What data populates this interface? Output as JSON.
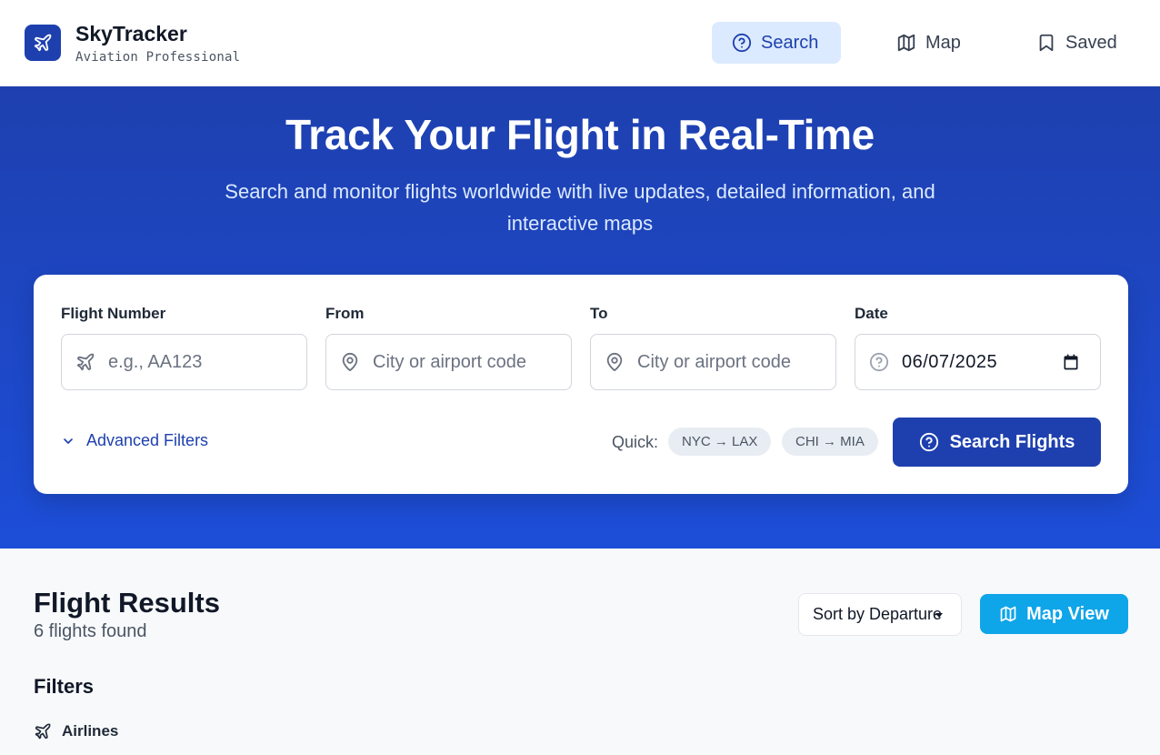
{
  "header": {
    "brand_name": "SkyTracker",
    "brand_sub": "Aviation Professional",
    "nav": [
      {
        "label": "Search",
        "icon": "help-circle-icon",
        "active": true
      },
      {
        "label": "Map",
        "icon": "map-icon",
        "active": false
      },
      {
        "label": "Saved",
        "icon": "bookmark-icon",
        "active": false
      }
    ]
  },
  "hero": {
    "title": "Track Your Flight in Real-Time",
    "subtitle": "Search and monitor flights worldwide with live updates, detailed information, and interactive maps"
  },
  "search_form": {
    "flight_number": {
      "label": "Flight Number",
      "placeholder": "e.g., AA123",
      "icon": "plane-icon"
    },
    "from": {
      "label": "From",
      "placeholder": "City or airport code",
      "icon": "map-pin-icon"
    },
    "to": {
      "label": "To",
      "placeholder": "City or airport code",
      "icon": "map-pin-icon"
    },
    "date": {
      "label": "Date",
      "value": "06/07/2025",
      "icon": "help-circle-icon"
    },
    "advanced_filters_label": "Advanced Filters",
    "quick_label": "Quick:",
    "quick_chips": [
      "NYC → LAX",
      "CHI → MIA"
    ],
    "submit_label": "Search Flights"
  },
  "results": {
    "title": "Flight Results",
    "count_text": "6 flights found",
    "sort_value": "Sort by Departure",
    "map_view_label": "Map View",
    "filters_title": "Filters",
    "airlines_label": "Airlines"
  },
  "colors": {
    "primary": "#1e40af",
    "accent": "#0ea5e9",
    "nav_active_bg": "#dbeafe"
  }
}
